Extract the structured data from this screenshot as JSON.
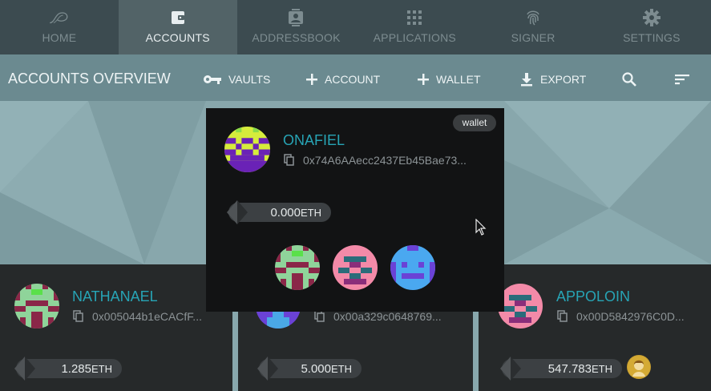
{
  "nav": [
    {
      "label": "HOME",
      "icon": "home-logo-icon",
      "active": false
    },
    {
      "label": "ACCOUNTS",
      "icon": "wallet-icon",
      "active": true
    },
    {
      "label": "ADDRESSBOOK",
      "icon": "addressbook-icon",
      "active": false
    },
    {
      "label": "APPLICATIONS",
      "icon": "apps-grid-icon",
      "active": false
    },
    {
      "label": "SIGNER",
      "icon": "fingerprint-icon",
      "active": false
    },
    {
      "label": "SETTINGS",
      "icon": "gear-icon",
      "active": false
    }
  ],
  "toolbar": {
    "title": "ACCOUNTS OVERVIEW",
    "vaults": "VAULTS",
    "account": "ACCOUNT",
    "wallet": "WALLET",
    "export": "EXPORT"
  },
  "popup": {
    "badge": "wallet",
    "name": "ONAFIEL",
    "address": "0x74A6AAecc2437Eb45Bae73...",
    "balance": "0.000",
    "unit": "ETH"
  },
  "cards": [
    {
      "name": "NATHANAEL",
      "address": "0x005044b1eCACfF...",
      "balance": "1.285",
      "unit": "ETH"
    },
    {
      "name": "",
      "address": "0x00a329c0648769...",
      "balance": "5.000",
      "unit": "ETH"
    },
    {
      "name": "APPOLOIN",
      "address": "0x00D5842976C0D...",
      "balance": "547.783",
      "unit": "ETH"
    }
  ],
  "colors": {
    "accent": "#27a4b5",
    "nav_bg": "#3c4b50",
    "nav_active": "#526367",
    "toolbar_bg": "#6b8a90",
    "card_bg": "#26292a",
    "popup_bg": "#121314"
  }
}
